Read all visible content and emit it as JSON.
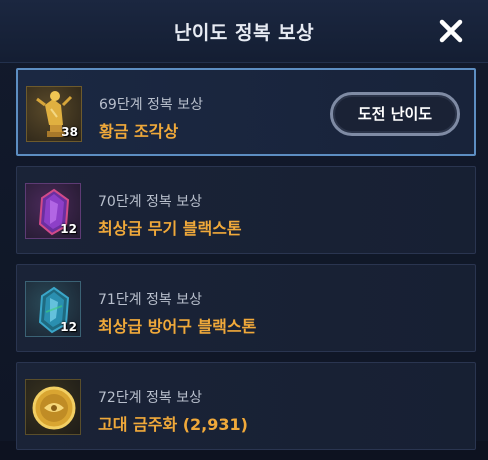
{
  "dialog": {
    "title": "난이도 정복 보상",
    "close_icon": "close-icon"
  },
  "rewards": [
    {
      "stage": "69단계 정복 보상",
      "reward": "황금 조각상",
      "count": "38",
      "icon": "golden-statue-icon",
      "selected": true
    },
    {
      "stage": "70단계 정복 보상",
      "reward": "최상급 무기 블랙스톤",
      "count": "12",
      "icon": "purple-blackstone-icon",
      "selected": false
    },
    {
      "stage": "71단계 정복 보상",
      "reward": "최상급 방어구 블랙스톤",
      "count": "12",
      "icon": "teal-blackstone-icon",
      "selected": false
    },
    {
      "stage": "72단계 정복 보상",
      "reward": "고대 금주화 (2,931)",
      "count": "",
      "icon": "ancient-gold-coin-icon",
      "selected": false
    }
  ],
  "challenge_button": {
    "label": "도전 난이도"
  },
  "colors": {
    "reward_text": "#f0a93a",
    "selected_border": "#5d8ec2",
    "background": "#121a2c"
  }
}
